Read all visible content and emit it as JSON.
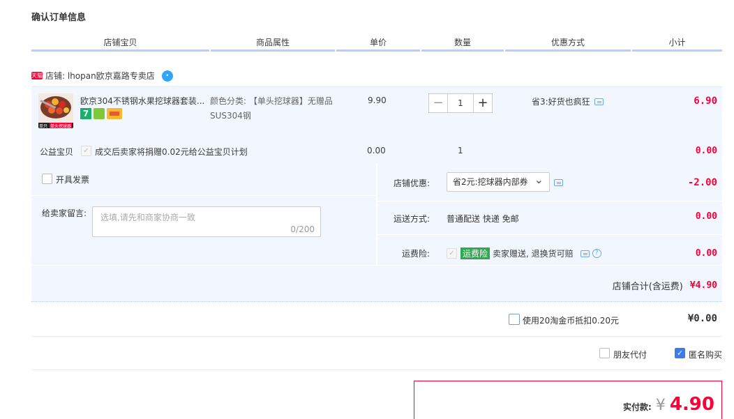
{
  "page_title": "确认订单信息",
  "columns": [
    "店铺宝贝",
    "商品属性",
    "单价",
    "数量",
    "优惠方式",
    "小计"
  ],
  "shop": {
    "badge": "天猫",
    "label": "店铺: lhopan欧京嘉路专卖店"
  },
  "item": {
    "thumb_label": "单头挖球器",
    "thumb_tag": "单只",
    "name": "欧京304不锈钢水果挖球器套装...",
    "icon_7": "7",
    "attr_line1": "颜色分类: 【单头挖球器】无赠品",
    "attr_line2": "SUS304钢",
    "price": "9.90",
    "qty": "1",
    "qty_minus": "−",
    "qty_plus": "+",
    "promo": "省3:好货也疯狂",
    "subtotal": "6.90"
  },
  "charity": {
    "label": "公益宝贝",
    "check_mark": "✓",
    "desc": "成交后卖家将捐赠0.02元给公益宝贝计划",
    "price": "0.00",
    "qty": "1",
    "subtotal": "0.00"
  },
  "invoice": {
    "label": "开具发票"
  },
  "memo": {
    "label": "给卖家留言:",
    "placeholder": "选填,请先和商家协商一致",
    "counter": "0/200"
  },
  "shop_discount": {
    "label": "店铺优惠:",
    "selected": "省2元:挖球器内部券",
    "chevron": "⌄",
    "amount": "-2.00"
  },
  "shipping": {
    "label": "运送方式:",
    "value": "普通配送 快递 免邮",
    "amount": "0.00"
  },
  "insurance": {
    "label": "运费险:",
    "tag": "运费险",
    "desc": "卖家赠送, 退换货可赔",
    "help": "?",
    "amount": "0.00"
  },
  "shop_total": {
    "label": "店铺合计(含运费)",
    "amount": "¥4.90"
  },
  "coins": {
    "label": "使用20淘金币抵扣0.20元",
    "amount": "¥0.00"
  },
  "friend_pay": {
    "label": "朋友代付"
  },
  "anonymous": {
    "label": "匿名购买",
    "check_mark": "✓"
  },
  "actual_pay": {
    "label": "实付款:",
    "currency": "¥",
    "amount": "4.90"
  },
  "colors": {
    "accent_red": "#ff0036",
    "header_underline": "#b2d1ff",
    "row_bg": "#f2f7ff",
    "checkbox_blue": "#3b7cea"
  }
}
